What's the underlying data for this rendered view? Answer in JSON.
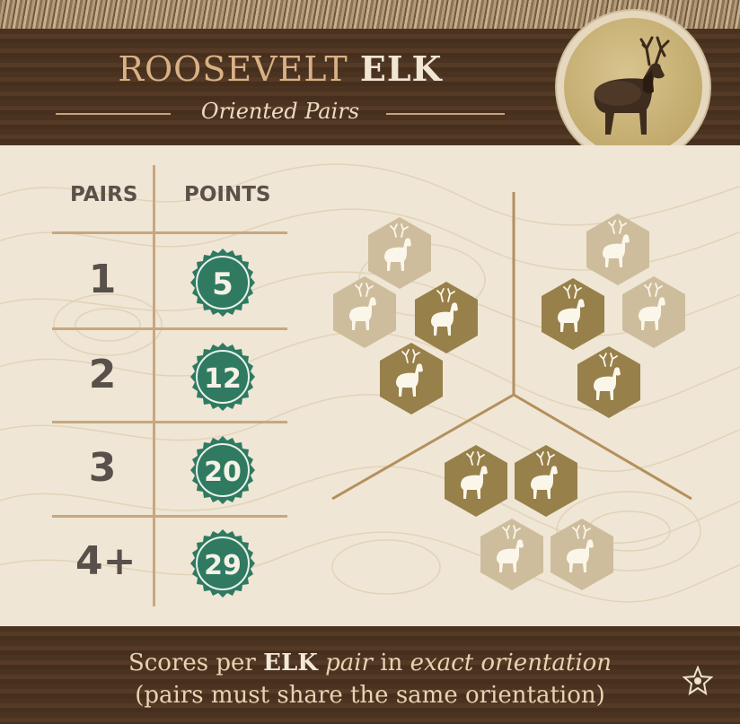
{
  "card": {
    "title_regular": "ROOSEVELT ",
    "title_bold": "ELK",
    "subtitle": "Oriented Pairs",
    "portrait_icon": "elk-portrait-icon"
  },
  "scoring_table": {
    "header_pairs": "PAIRS",
    "header_points": "POINTS",
    "rows": [
      {
        "pairs": "1",
        "points": "5"
      },
      {
        "pairs": "2",
        "points": "12"
      },
      {
        "pairs": "3",
        "points": "20"
      },
      {
        "pairs": "4+",
        "points": "29"
      }
    ]
  },
  "patterns": {
    "tile_icon": "elk-icon",
    "colors": {
      "gold": "#97804a",
      "faded": "#cdbd9c"
    }
  },
  "footer": {
    "line1_a": "Scores per ",
    "line1_b": "ELK",
    "line1_c": " pair",
    "line1_d": " in ",
    "line1_e": "exact orientation",
    "line2": "(pairs must share the same orientation)",
    "badge_icon": "star-icon"
  },
  "colors": {
    "header_wood": "#4b3321",
    "board": "#efe6d5",
    "accent_tan": "#c9a67f",
    "badge_green": "#2f7a60",
    "title_tan": "#d9b184"
  }
}
